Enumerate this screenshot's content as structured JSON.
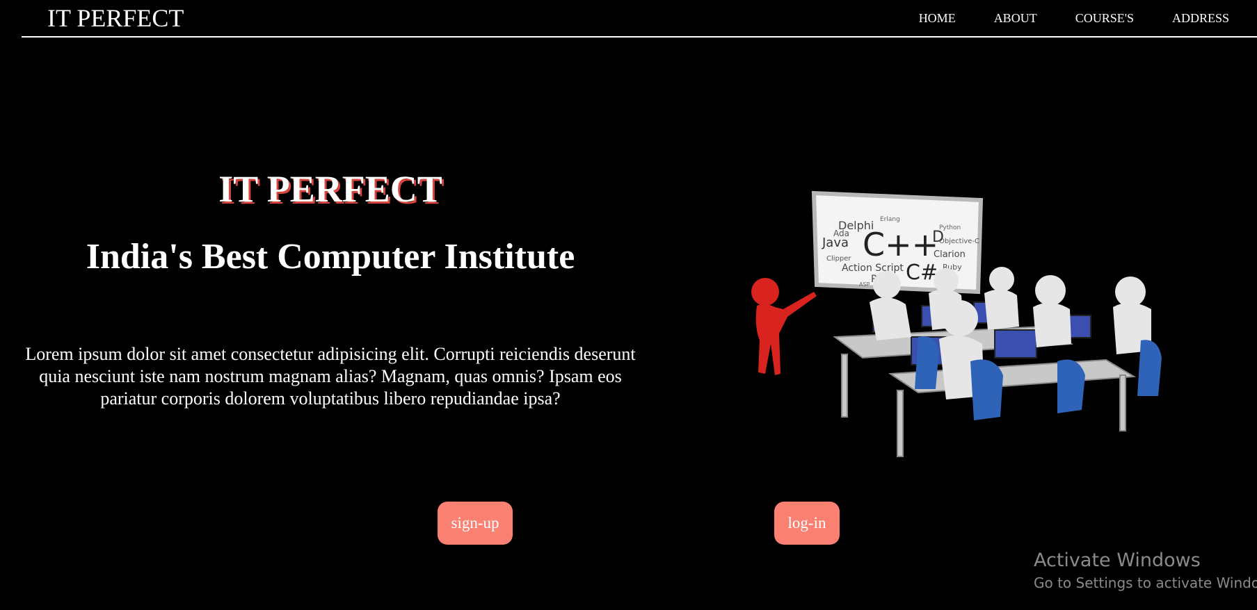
{
  "header": {
    "brand": "IT PERFECT",
    "nav": [
      {
        "label": "HOME"
      },
      {
        "label": "ABOUT"
      },
      {
        "label": "COURSE'S"
      },
      {
        "label": "ADDRESS"
      }
    ]
  },
  "hero": {
    "title": "IT PERFECT",
    "subtitle": "India's Best Computer Institute",
    "description": "Lorem ipsum dolor sit amet consectetur adipisicing elit. Corrupti reiciendis deserunt quia nesciunt iste nam nostrum magnam alias? Magnam, quas omnis? Ipsam eos pariatur corporis dolorem voluptatibus libero repudiandae ipsa?",
    "signup_label": "sign-up",
    "login_label": "log-in"
  },
  "illustration": {
    "board_words": [
      "Delphi",
      "Java",
      "C++",
      "D",
      "Objective-C",
      "Clarion",
      "Ruby",
      "Action Script",
      "C#",
      "Perl",
      "Ada",
      "Python",
      "Clipper",
      "Erlang",
      "ASP"
    ]
  },
  "watermark": {
    "title": "Activate Windows",
    "subtitle": "Go to Settings to activate Windows."
  },
  "colors": {
    "background": "#000000",
    "button": "#fa8072",
    "title_shadow": "#d9463f"
  }
}
